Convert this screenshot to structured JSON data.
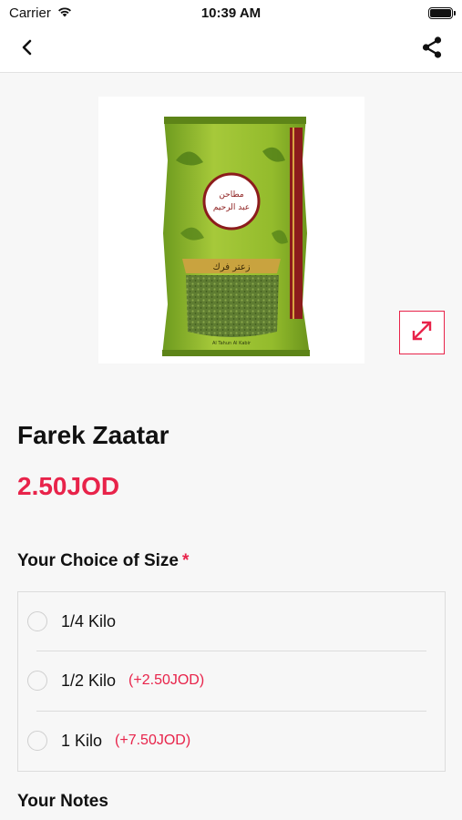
{
  "status_bar": {
    "carrier": "Carrier",
    "time": "10:39 AM",
    "icons": [
      "wifi-icon",
      "battery-icon"
    ]
  },
  "nav_bar": {
    "back_icon": "chevron-left-icon",
    "share_icon": "share-icon"
  },
  "product": {
    "image_icon": "product-image",
    "image_brand_text": "مطاحن عبد الرحيم",
    "image_product_text": "زعتر فرك",
    "expand_icon": "expand-icon",
    "name": "Farek Zaatar",
    "price": "2.50JOD"
  },
  "size_section": {
    "title": "Your Choice of Size",
    "required_marker": "*",
    "options": [
      {
        "label": "1/4 Kilo",
        "extra": ""
      },
      {
        "label": "1/2 Kilo",
        "extra": "(+2.50JOD)"
      },
      {
        "label": "1 Kilo",
        "extra": "(+7.50JOD)"
      }
    ]
  },
  "notes_section": {
    "title": "Your Notes"
  },
  "colors": {
    "accent": "#e8234a",
    "background": "#f7f7f7",
    "text": "#111111"
  }
}
